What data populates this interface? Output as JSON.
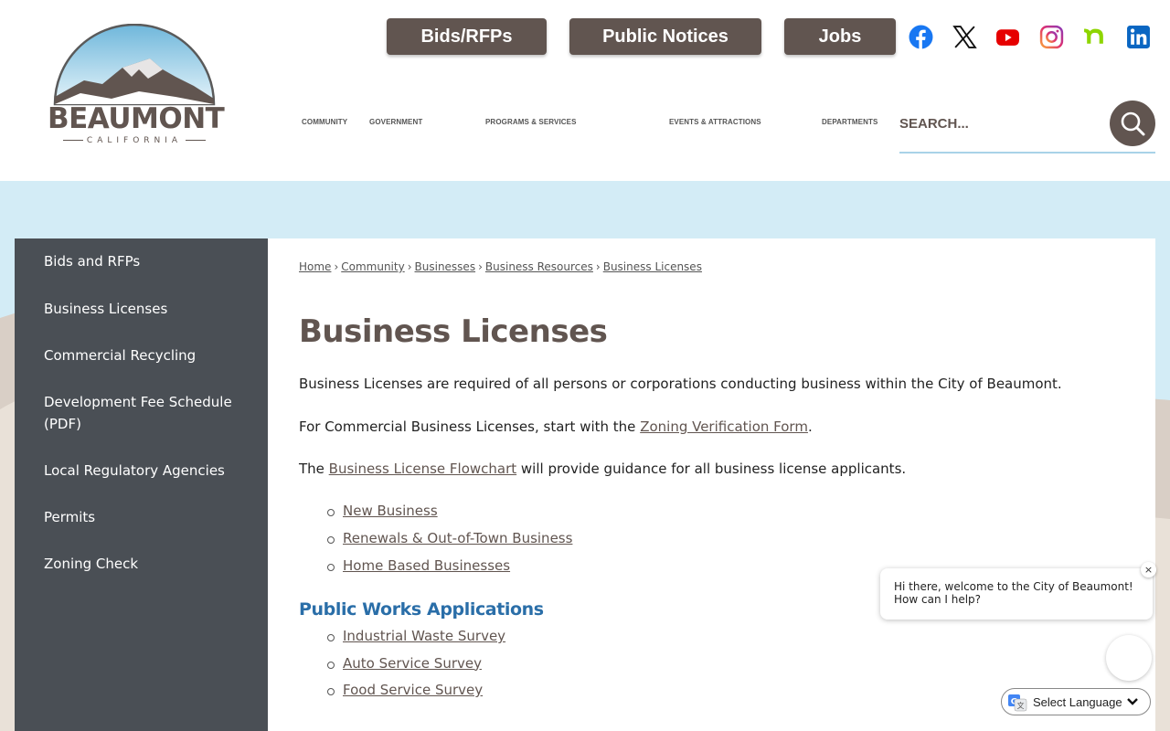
{
  "brand": {
    "name": "BEAUMONT",
    "subtitle": "CALIFORNIA"
  },
  "quick_links": [
    {
      "label": "Bids/RFPs"
    },
    {
      "label": "Public Notices"
    },
    {
      "label": "Jobs"
    }
  ],
  "social_icons": [
    "facebook-icon",
    "x-icon",
    "youtube-icon",
    "instagram-icon",
    "nextdoor-icon",
    "linkedin-icon"
  ],
  "nav": [
    {
      "label": "Community"
    },
    {
      "label": "Government"
    },
    {
      "label": "Programs & Services"
    },
    {
      "label": "Events & Attractions"
    },
    {
      "label": "Departments"
    }
  ],
  "search": {
    "placeholder": "SEARCH..."
  },
  "sidebar": {
    "items": [
      {
        "label": "Bids and RFPs"
      },
      {
        "label": "Business Licenses"
      },
      {
        "label": "Commercial Recycling"
      },
      {
        "label": "Development Fee Schedule (PDF)"
      },
      {
        "label": "Local Regulatory Agencies"
      },
      {
        "label": "Permits"
      },
      {
        "label": "Zoning Check"
      }
    ]
  },
  "breadcrumb": [
    {
      "label": "Home"
    },
    {
      "label": "Community"
    },
    {
      "label": "Businesses"
    },
    {
      "label": "Business Resources"
    },
    {
      "label": "Business Licenses"
    }
  ],
  "page": {
    "title": "Business Licenses",
    "intro": "Business Licenses are required of all persons or corporations conducting business within the City of Beaumont.",
    "commercial_prefix": "For Commercial Business Licenses, start with the ",
    "commercial_link": "Zoning Verification Form",
    "commercial_suffix": ".",
    "flowchart_prefix": "The ",
    "flowchart_link": "Business License Flowchart",
    "flowchart_suffix": " will provide guidance for all business license applicants.",
    "license_links": [
      {
        "label": "New Business"
      },
      {
        "label": "Renewals & Out-of-Town Business"
      },
      {
        "label": "Home Based Businesses"
      }
    ],
    "public_works_heading": "Public Works Applications",
    "public_works_links": [
      {
        "label": "Industrial Waste Survey"
      },
      {
        "label": "Auto Service Survey"
      },
      {
        "label": "Food Service Survey"
      }
    ]
  },
  "chat": {
    "message_line1": "Hi there, welcome to the City of Beaumont!",
    "message_line2": "How can I help?",
    "close_glyph": "×"
  },
  "language": {
    "label": "Select Language"
  },
  "colors": {
    "brand_brown": "#615550",
    "sidebar_bg": "#4a4f55",
    "sky_band": "#d3ecf6",
    "heading_blue": "#2a6ea8"
  }
}
